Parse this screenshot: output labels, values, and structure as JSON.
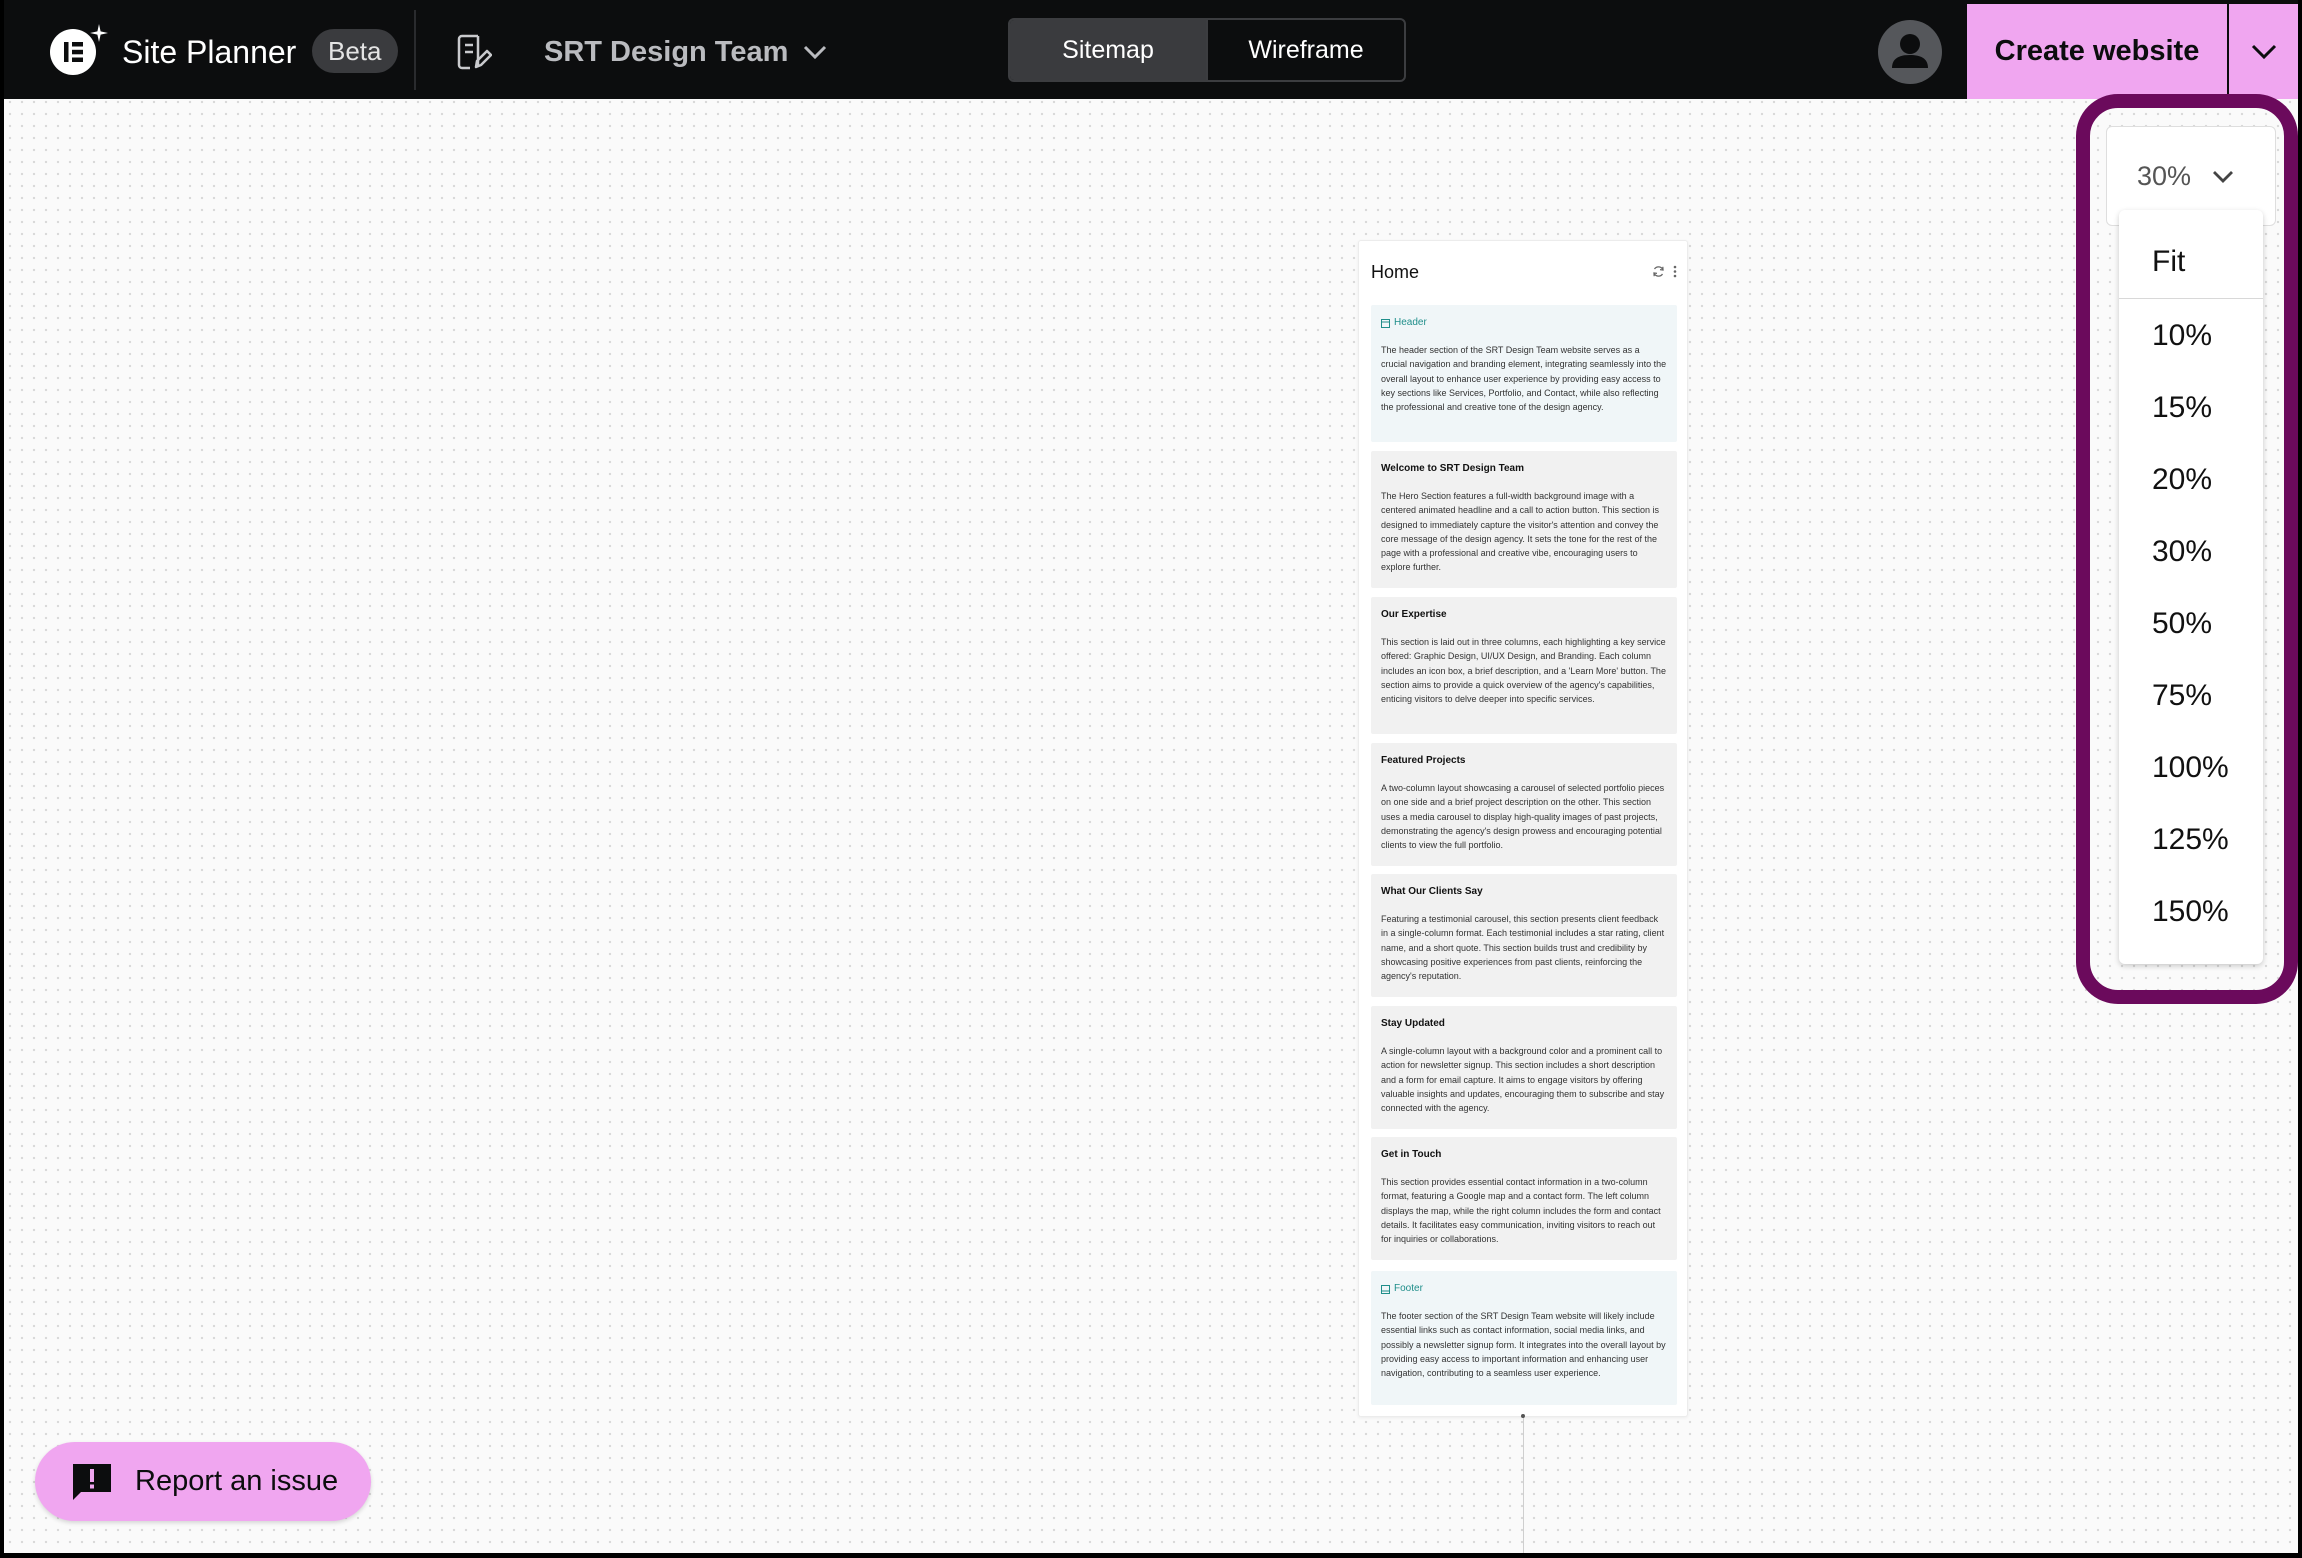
{
  "topbar": {
    "app_title": "Site Planner",
    "beta_label": "Beta",
    "team_name": "SRT Design Team",
    "view_tabs": [
      {
        "label": "Sitemap",
        "active": true
      },
      {
        "label": "Wireframe",
        "active": false
      }
    ],
    "create_label": "Create website"
  },
  "page": {
    "title": "Home",
    "sections": [
      {
        "title": "Header",
        "kind": "header",
        "desc": "The header section of the SRT Design Team website serves as a crucial navigation and branding element, integrating seamlessly into the overall layout to enhance user experience by providing easy access to key sections like Services, Portfolio, and Contact, while also reflecting the professional and creative tone of the design agency."
      },
      {
        "title": "Welcome to SRT Design Team",
        "kind": "section",
        "desc": "The Hero Section features a full-width background image with a centered animated headline and a call to action button. This section is designed to immediately capture the visitor's attention and convey the core message of the design agency. It sets the tone for the rest of the page with a professional and creative vibe, encouraging users to explore further."
      },
      {
        "title": "Our Expertise",
        "kind": "section",
        "desc": "This section is laid out in three columns, each highlighting a key service offered: Graphic Design, UI/UX Design, and Branding. Each column includes an icon box, a brief description, and a 'Learn More' button. The section aims to provide a quick overview of the agency's capabilities, enticing visitors to delve deeper into specific services."
      },
      {
        "title": "Featured Projects",
        "kind": "section",
        "desc": "A two-column layout showcasing a carousel of selected portfolio pieces on one side and a brief project description on the other. This section uses a media carousel to display high-quality images of past projects, demonstrating the agency's design prowess and encouraging potential clients to view the full portfolio."
      },
      {
        "title": "What Our Clients Say",
        "kind": "section",
        "desc": "Featuring a testimonial carousel, this section presents client feedback in a single-column format. Each testimonial includes a star rating, client name, and a short quote. This section builds trust and credibility by showcasing positive experiences from past clients, reinforcing the agency's reputation."
      },
      {
        "title": "Stay Updated",
        "kind": "section",
        "desc": "A single-column layout with a background color and a prominent call to action for newsletter signup. This section includes a short description and a form for email capture. It aims to engage visitors by offering valuable insights and updates, encouraging them to subscribe and stay connected with the agency."
      },
      {
        "title": "Get in Touch",
        "kind": "section",
        "desc": "This section provides essential contact information in a two-column format, featuring a Google map and a contact form. The left column displays the map, while the right column includes the form and contact details. It facilitates easy communication, inviting visitors to reach out for inquiries or collaborations."
      },
      {
        "title": "Footer",
        "kind": "footer",
        "desc": "The footer section of the SRT Design Team website will likely include essential links such as contact information, social media links, and possibly a newsletter signup form. It integrates into the overall layout by providing easy access to important information and enhancing user navigation, contributing to a seamless user experience."
      }
    ]
  },
  "zoom": {
    "current": "30%",
    "options": [
      "Fit",
      "10%",
      "15%",
      "20%",
      "30%",
      "50%",
      "75%",
      "100%",
      "125%",
      "150%"
    ]
  },
  "report": {
    "label": "Report an issue"
  },
  "colors": {
    "accent": "#f0a6f0",
    "highlight": "#6b0a5c",
    "topbar": "#0c0d0e",
    "teal": "#1f8e8a"
  }
}
